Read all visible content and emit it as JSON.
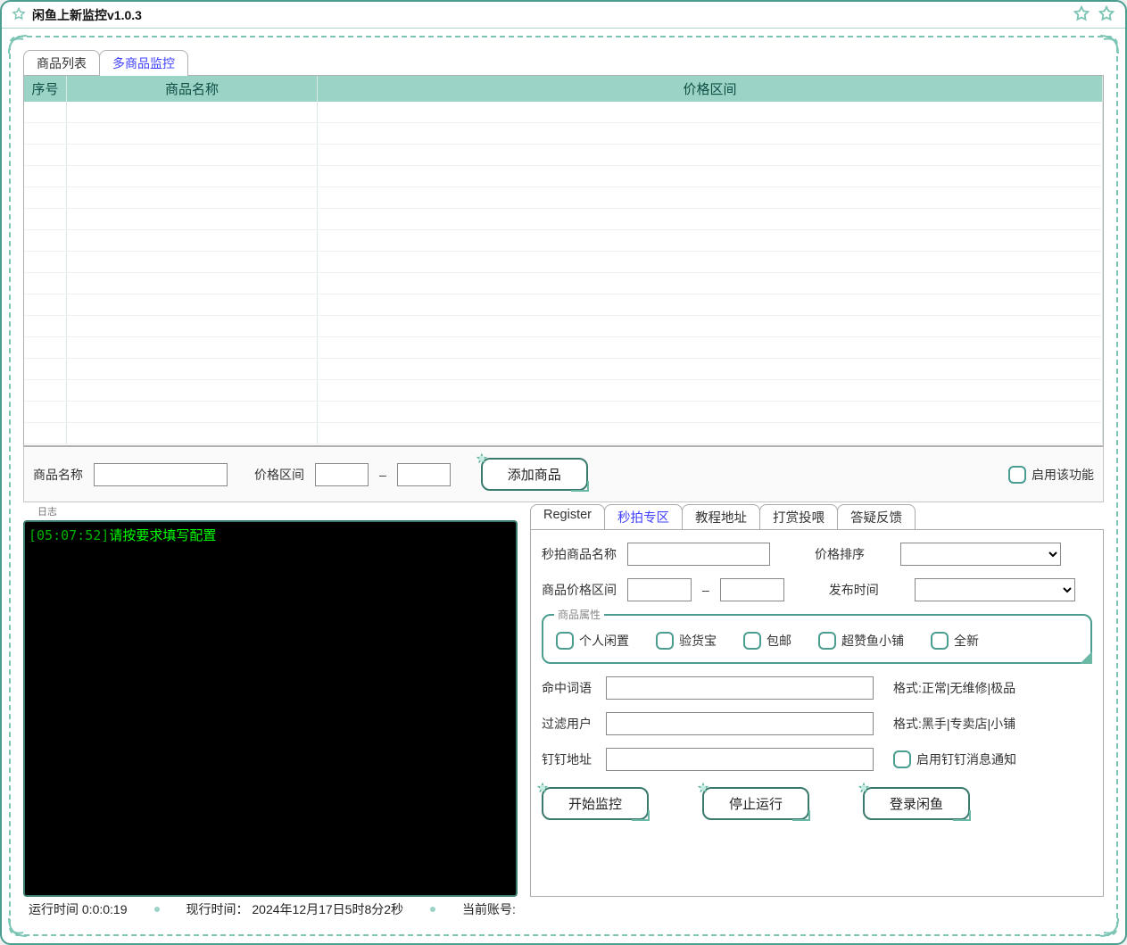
{
  "window": {
    "title": "闲鱼上新监控v1.0.3"
  },
  "top_tabs": [
    {
      "label": "商品列表",
      "active": false
    },
    {
      "label": "多商品监控",
      "active": true
    }
  ],
  "table": {
    "columns": [
      "序号",
      "商品名称",
      "价格区间"
    ],
    "row_count": 16
  },
  "add_bar": {
    "name_label": "商品名称",
    "price_label": "价格区间",
    "dash": "–",
    "add_button": "添加商品",
    "enable_label": "启用该功能"
  },
  "log": {
    "section_label": "日志",
    "lines": [
      {
        "ts": "[05:07:52]",
        "msg": "请按要求填写配置"
      }
    ]
  },
  "right": {
    "tabs": [
      {
        "label": "Register",
        "active": false
      },
      {
        "label": "秒拍专区",
        "active": true
      },
      {
        "label": "教程地址",
        "active": false
      },
      {
        "label": "打赏投喂",
        "active": false
      },
      {
        "label": "答疑反馈",
        "active": false
      }
    ],
    "form": {
      "name_label": "秒拍商品名称",
      "price_label": "商品价格区间",
      "dash": "–",
      "sort_label": "价格排序",
      "time_label": "发布时间"
    },
    "filter": {
      "legend": "商品属性",
      "options": [
        "个人闲置",
        "验货宝",
        "包邮",
        "超赞鱼小铺",
        "全新"
      ]
    },
    "keyword": {
      "label": "命中词语",
      "hint": "格式:正常|无维修|极品"
    },
    "blocked": {
      "label": "过滤用户",
      "hint": "格式:黑手|专卖店|小铺"
    },
    "dingding": {
      "label": "钉钉地址",
      "enable_label": "启用钉钉消息通知"
    },
    "actions": {
      "start": "开始监控",
      "stop": "停止运行",
      "login": "登录闲鱼"
    }
  },
  "status": {
    "runtime_label": "运行时间",
    "runtime_value": "0:0:0:19",
    "now_label": "现行时间：",
    "now_value": "2024年12月17日5时8分2秒",
    "account_label": "当前账号:"
  }
}
